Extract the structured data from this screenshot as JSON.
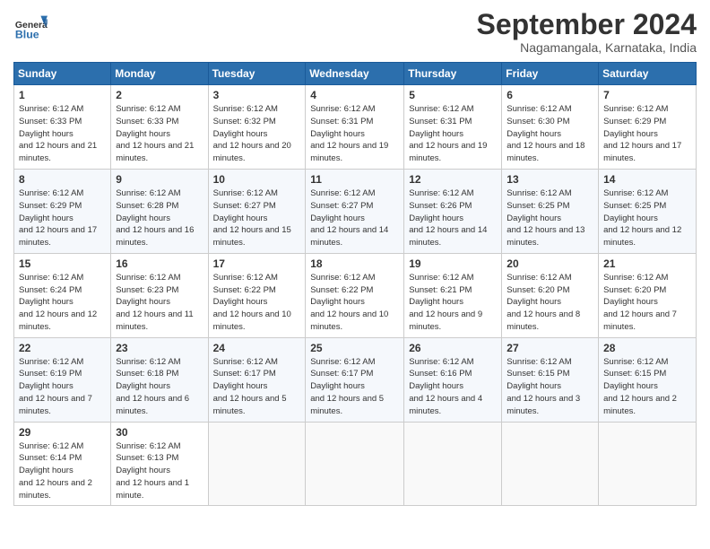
{
  "header": {
    "logo_general": "General",
    "logo_blue": "Blue",
    "month_title": "September 2024",
    "location": "Nagamangala, Karnataka, India"
  },
  "calendar": {
    "days_of_week": [
      "Sunday",
      "Monday",
      "Tuesday",
      "Wednesday",
      "Thursday",
      "Friday",
      "Saturday"
    ],
    "weeks": [
      [
        null,
        null,
        null,
        null,
        null,
        null,
        null
      ]
    ],
    "cells": [
      {
        "day": null,
        "info": ""
      },
      {
        "day": null,
        "info": ""
      },
      {
        "day": null,
        "info": ""
      },
      {
        "day": null,
        "info": ""
      },
      {
        "day": null,
        "info": ""
      },
      {
        "day": null,
        "info": ""
      },
      {
        "day": null,
        "info": ""
      },
      {
        "day": "1",
        "sunrise": "6:12 AM",
        "sunset": "6:33 PM",
        "daylight": "12 hours and 21 minutes."
      },
      {
        "day": "2",
        "sunrise": "6:12 AM",
        "sunset": "6:33 PM",
        "daylight": "12 hours and 21 minutes."
      },
      {
        "day": "3",
        "sunrise": "6:12 AM",
        "sunset": "6:32 PM",
        "daylight": "12 hours and 20 minutes."
      },
      {
        "day": "4",
        "sunrise": "6:12 AM",
        "sunset": "6:31 PM",
        "daylight": "12 hours and 19 minutes."
      },
      {
        "day": "5",
        "sunrise": "6:12 AM",
        "sunset": "6:31 PM",
        "daylight": "12 hours and 19 minutes."
      },
      {
        "day": "6",
        "sunrise": "6:12 AM",
        "sunset": "6:30 PM",
        "daylight": "12 hours and 18 minutes."
      },
      {
        "day": "7",
        "sunrise": "6:12 AM",
        "sunset": "6:29 PM",
        "daylight": "12 hours and 17 minutes."
      },
      {
        "day": "8",
        "sunrise": "6:12 AM",
        "sunset": "6:29 PM",
        "daylight": "12 hours and 17 minutes."
      },
      {
        "day": "9",
        "sunrise": "6:12 AM",
        "sunset": "6:28 PM",
        "daylight": "12 hours and 16 minutes."
      },
      {
        "day": "10",
        "sunrise": "6:12 AM",
        "sunset": "6:27 PM",
        "daylight": "12 hours and 15 minutes."
      },
      {
        "day": "11",
        "sunrise": "6:12 AM",
        "sunset": "6:27 PM",
        "daylight": "12 hours and 14 minutes."
      },
      {
        "day": "12",
        "sunrise": "6:12 AM",
        "sunset": "6:26 PM",
        "daylight": "12 hours and 14 minutes."
      },
      {
        "day": "13",
        "sunrise": "6:12 AM",
        "sunset": "6:25 PM",
        "daylight": "12 hours and 13 minutes."
      },
      {
        "day": "14",
        "sunrise": "6:12 AM",
        "sunset": "6:25 PM",
        "daylight": "12 hours and 12 minutes."
      },
      {
        "day": "15",
        "sunrise": "6:12 AM",
        "sunset": "6:24 PM",
        "daylight": "12 hours and 12 minutes."
      },
      {
        "day": "16",
        "sunrise": "6:12 AM",
        "sunset": "6:23 PM",
        "daylight": "12 hours and 11 minutes."
      },
      {
        "day": "17",
        "sunrise": "6:12 AM",
        "sunset": "6:22 PM",
        "daylight": "12 hours and 10 minutes."
      },
      {
        "day": "18",
        "sunrise": "6:12 AM",
        "sunset": "6:22 PM",
        "daylight": "12 hours and 10 minutes."
      },
      {
        "day": "19",
        "sunrise": "6:12 AM",
        "sunset": "6:21 PM",
        "daylight": "12 hours and 9 minutes."
      },
      {
        "day": "20",
        "sunrise": "6:12 AM",
        "sunset": "6:20 PM",
        "daylight": "12 hours and 8 minutes."
      },
      {
        "day": "21",
        "sunrise": "6:12 AM",
        "sunset": "6:20 PM",
        "daylight": "12 hours and 7 minutes."
      },
      {
        "day": "22",
        "sunrise": "6:12 AM",
        "sunset": "6:19 PM",
        "daylight": "12 hours and 7 minutes."
      },
      {
        "day": "23",
        "sunrise": "6:12 AM",
        "sunset": "6:18 PM",
        "daylight": "12 hours and 6 minutes."
      },
      {
        "day": "24",
        "sunrise": "6:12 AM",
        "sunset": "6:17 PM",
        "daylight": "12 hours and 5 minutes."
      },
      {
        "day": "25",
        "sunrise": "6:12 AM",
        "sunset": "6:17 PM",
        "daylight": "12 hours and 5 minutes."
      },
      {
        "day": "26",
        "sunrise": "6:12 AM",
        "sunset": "6:16 PM",
        "daylight": "12 hours and 4 minutes."
      },
      {
        "day": "27",
        "sunrise": "6:12 AM",
        "sunset": "6:15 PM",
        "daylight": "12 hours and 3 minutes."
      },
      {
        "day": "28",
        "sunrise": "6:12 AM",
        "sunset": "6:15 PM",
        "daylight": "12 hours and 2 minutes."
      },
      {
        "day": "29",
        "sunrise": "6:12 AM",
        "sunset": "6:14 PM",
        "daylight": "12 hours and 2 minutes."
      },
      {
        "day": "30",
        "sunrise": "6:12 AM",
        "sunset": "6:13 PM",
        "daylight": "12 hours and 1 minute."
      },
      null,
      null,
      null,
      null,
      null
    ]
  }
}
